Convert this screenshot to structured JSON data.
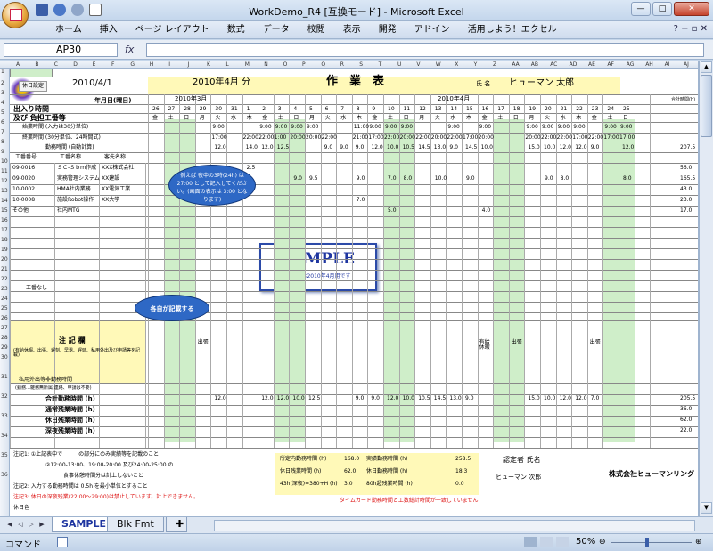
{
  "window": {
    "title": "WorkDemo_R4 [互換モード] - Microsoft Excel"
  },
  "ribbon": {
    "tabs": [
      "ホーム",
      "挿入",
      "ページ レイアウト",
      "数式",
      "データ",
      "校閲",
      "表示",
      "開発",
      "アドイン",
      "活用しよう！エクセル"
    ]
  },
  "formula": {
    "name_box": "AP30",
    "fx": "fx",
    "content": ""
  },
  "columns": [
    "A",
    "B",
    "C",
    "D",
    "E",
    "F",
    "G",
    "H",
    "I",
    "J",
    "K",
    "L",
    "M",
    "N",
    "O",
    "P",
    "Q",
    "R",
    "S",
    "T",
    "U",
    "V",
    "W",
    "X",
    "Y",
    "Z",
    "AA",
    "AB",
    "AC",
    "AD",
    "AE",
    "AF",
    "AG",
    "AH",
    "AI",
    "AJ"
  ],
  "rows": [
    "1",
    "2",
    "3",
    "4",
    "5",
    "6",
    "7",
    "8",
    "9",
    "10",
    "11",
    "12",
    "13",
    "14",
    "15",
    "16",
    "17",
    "18",
    "19",
    "20",
    "21",
    "22",
    "23",
    "24",
    "25",
    "26",
    "27",
    "28",
    "29",
    "30",
    "31",
    "32",
    "33",
    "34",
    "35",
    "36"
  ],
  "sheet": {
    "settings_btn": "休日設定",
    "date": "2010/4/1",
    "month_title": "2010年4月 分",
    "doc_title": "作　業　表",
    "name_label": "氏 名",
    "person_name": "ヒューマン 太郎",
    "prev_month": "2010年3月",
    "cur_month": "2010年4月",
    "date_label": "年月日(曜日)",
    "io_label": "出入り時間",
    "load_label": "及び 負担工番等",
    "total_hdr": "合計時間(h)",
    "start_label": "始業時間 (入力は30分単位)",
    "end_label": "終業時間 (30分単位、24時間式)",
    "work_label": "勤務時間 (自動計算)",
    "job_hdrs": [
      "工番番号",
      "工番名称",
      "客先名称"
    ],
    "days": [
      "26",
      "27",
      "28",
      "29",
      "30",
      "31",
      "1",
      "2",
      "3",
      "4",
      "5",
      "6",
      "7",
      "8",
      "9",
      "10",
      "11",
      "12",
      "13",
      "14",
      "15",
      "16",
      "17",
      "18",
      "19",
      "20",
      "21",
      "22",
      "23",
      "24",
      "25",
      "26"
    ],
    "weekdays": [
      "金",
      "土",
      "日",
      "月",
      "火",
      "水",
      "木",
      "金",
      "土",
      "日",
      "月",
      "火",
      "水",
      "木",
      "金",
      "土",
      "日",
      "月",
      "火",
      "水",
      "木",
      "金",
      "土",
      "日",
      "月",
      "火",
      "水",
      "木",
      "金",
      "土",
      "日",
      "月"
    ],
    "start_times": [
      "",
      "",
      "",
      "",
      "9:00",
      "",
      "",
      "9:00",
      "9:00",
      "9:00",
      "9:00",
      "",
      "",
      "11:00",
      "9:00",
      "9:00",
      "9:00",
      "",
      "",
      "9:00",
      "",
      "9:00",
      "",
      "",
      "9:00",
      "9:00",
      "9:00",
      "9:00",
      "",
      "9:00",
      "9:00"
    ],
    "end_times": [
      "",
      "",
      "",
      "",
      "17:00",
      "",
      "22:00",
      "22:00",
      "1:00",
      "20:00",
      "20:00",
      "22:00",
      "",
      "21:00",
      "17:00",
      "22:00",
      "20:00",
      "22:00",
      "20:00",
      "22:00",
      "17:00",
      "20:00",
      "",
      "",
      "20:00",
      "22:00",
      "22:00",
      "17:00",
      "22:00",
      "17:00",
      "17:00"
    ],
    "work_hours": [
      "",
      "",
      "",
      "",
      "12.0",
      "",
      "14.0",
      "12.0",
      "12.5",
      "",
      "",
      "9.0",
      "9.0",
      "9.0",
      "12.0",
      "10.0",
      "10.5",
      "14.5",
      "13.0",
      "9.0",
      "14.5",
      "10.0",
      "",
      "",
      "15.0",
      "10.0",
      "12.0",
      "12.0",
      "9.0",
      "",
      "12.0"
    ],
    "work_total": "207.5",
    "jobs": [
      {
        "no": "09-0016",
        "name": "ＳＣ-Ｓｂｍ作成",
        "client": "XXX株式会社",
        "vals": [
          "",
          "",
          "",
          "",
          "",
          "",
          "2.5",
          "",
          "",
          "",
          "",
          "",
          "",
          "",
          "",
          "",
          "",
          "",
          "",
          "",
          "",
          "",
          "",
          "",
          "",
          "",
          "",
          "",
          "",
          "",
          ""
        ],
        "total": "56.0"
      },
      {
        "no": "09-0020",
        "name": "実務管理システム",
        "client": "XX建設",
        "vals": [
          "",
          "",
          "",
          "",
          "",
          "",
          "",
          "",
          "",
          "9.0",
          "9.5",
          "",
          "",
          "9.0",
          "",
          "7.0",
          "8.0",
          "",
          "10.0",
          "",
          "9.0",
          "",
          "",
          "",
          "",
          "9.0",
          "8.0",
          "",
          "",
          "",
          "8.0"
        ],
        "total": "165.5"
      },
      {
        "no": "10-0002",
        "name": "HMA社内業務",
        "client": "XX電気工業",
        "vals": [
          "",
          "",
          "",
          "",
          "",
          "",
          "",
          "",
          "",
          "",
          "",
          "",
          "",
          "",
          "",
          "",
          "",
          "",
          "",
          "",
          "",
          "",
          "",
          "",
          "",
          "",
          "",
          "",
          "",
          "",
          ""
        ],
        "total": "43.0"
      },
      {
        "no": "10-0008",
        "name": "施設Robot操作",
        "client": "XX大学",
        "vals": [
          "",
          "",
          "",
          "",
          "",
          "",
          "",
          "",
          "",
          "",
          "",
          "",
          "",
          "7.0",
          "",
          "",
          "",
          "",
          "",
          "",
          "",
          "",
          "",
          "",
          "",
          "",
          "",
          "",
          "",
          "",
          ""
        ],
        "total": "23.0"
      },
      {
        "no": "その他",
        "name": "社内MTG",
        "client": "",
        "vals": [
          "",
          "",
          "",
          "",
          "",
          "",
          "",
          "",
          "",
          "",
          "",
          "",
          "",
          "",
          "",
          "5.0",
          "",
          "",
          "",
          "",
          "",
          "4.0",
          "",
          "",
          "",
          "",
          "",
          "",
          "",
          "",
          ""
        ],
        "total": "17.0"
      }
    ],
    "remarks_label": "注 記 欄",
    "remarks_sub": "(有給休暇、出張、遅刻、早退、遅延、私用外出及び申請等を記載)",
    "shukkin": "出張",
    "kyuka": "有給休暇",
    "private_label": "私用外出等非勤務時間",
    "private_sub": "(勤務…雑務無所属:連絡、申請は不要)",
    "job_nashi": "工番なし",
    "sum_labels": [
      "合計勤務時間 (h)",
      "通常残業時間 (h)",
      "休日残業時間 (h)",
      "深夜残業時間 (h)"
    ],
    "sum_totals": [
      "205.5",
      "36.0",
      "62.0",
      "22.0"
    ],
    "sum_hours": [
      "",
      "",
      "",
      "",
      "12.0",
      "",
      "",
      "12.0",
      "12.0",
      "10.0",
      "12.5",
      "",
      "",
      "9.0",
      "9.0",
      "12.0",
      "10.0",
      "10.5",
      "14.5",
      "13.0",
      "9.0",
      "",
      "",
      "",
      "15.0",
      "10.0",
      "12.0",
      "12.0",
      "7.0",
      "",
      ""
    ],
    "notes": [
      "注記1: ①上記表中で　　　の部分にのみ実績等を記載のこと",
      "②12:00-13:00、19:00-20:00 及び24:00-25:00 の",
      "食事休憩時間分は計上しないこと",
      "注記2: 入力する勤務時間は 0.5h を最小単位とすること",
      "注記3: 休日の深夜残業(22:00～29:00)は禁止しています。計上できません。",
      "休日色"
    ],
    "summary": [
      {
        "label": "所定内勤務時間 (h)",
        "val": "168.0",
        "label2": "実績勤務時間 (h)",
        "val2": "258.5"
      },
      {
        "label": "休日残業時間 (h)",
        "val": "62.0",
        "label2": "休日勤務時間 (h)",
        "val2": "18.3"
      },
      {
        "label": "43h(深夜)=380+H (h)",
        "val": "3.0",
        "label2": "80h超残業時間 (h)",
        "val2": "0.0"
      }
    ],
    "approver_label": "認定者 氏名",
    "approver_name": "ヒューマン 次郎",
    "company": "株式会社ヒューマンリング",
    "timecard_note": "タイムカード勤務時間と工数総計時間が一致していません",
    "sample_title": "SAMPLE",
    "sample_sub": "本帳票は2010年4月用です",
    "callout1": "例えば 夜中の3時(24h) は 27:00 として記入してください。(画面の表示は 3:00 となります)",
    "callout2": "各自が記載する"
  },
  "sheet_tabs": [
    "SAMPLE",
    "Blk Fmt"
  ],
  "status": {
    "mode": "コマンド",
    "zoom": "50%"
  }
}
